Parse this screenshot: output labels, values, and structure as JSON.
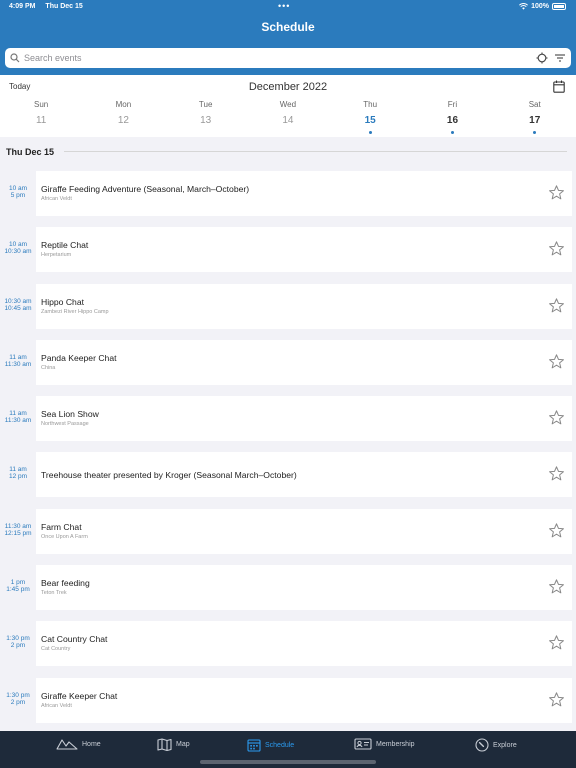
{
  "status_bar": {
    "time": "4:09 PM",
    "date": "Thu Dec 15",
    "battery": "100%"
  },
  "header": {
    "title": "Schedule"
  },
  "search": {
    "placeholder": "Search events"
  },
  "calendar": {
    "today_label": "Today",
    "month": "December 2022",
    "days": [
      {
        "name": "Sun",
        "num": "11"
      },
      {
        "name": "Mon",
        "num": "12"
      },
      {
        "name": "Tue",
        "num": "13"
      },
      {
        "name": "Wed",
        "num": "14"
      },
      {
        "name": "Thu",
        "num": "15"
      },
      {
        "name": "Fri",
        "num": "16"
      },
      {
        "name": "Sat",
        "num": "17"
      }
    ]
  },
  "list": {
    "date_header": "Thu Dec 15",
    "events": [
      {
        "start": "10 am",
        "end": "5 pm",
        "title": "Giraffe Feeding Adventure (Seasonal, March–October)",
        "location": "African Veldt"
      },
      {
        "start": "10 am",
        "end": "10:30 am",
        "title": "Reptile Chat",
        "location": "Herpetarium"
      },
      {
        "start": "10:30 am",
        "end": "10:45 am",
        "title": "Hippo Chat",
        "location": "Zambezi River Hippo Camp"
      },
      {
        "start": "11 am",
        "end": "11:30 am",
        "title": "Panda Keeper Chat",
        "location": "China"
      },
      {
        "start": "11 am",
        "end": "11:30 am",
        "title": "Sea Lion Show",
        "location": "Northwest Passage"
      },
      {
        "start": "11 am",
        "end": "12 pm",
        "title": "Treehouse theater presented by Kroger (Seasonal March–October)",
        "location": ""
      },
      {
        "start": "11:30 am",
        "end": "12:15 pm",
        "title": "Farm Chat",
        "location": "Once Upon A Farm"
      },
      {
        "start": "1 pm",
        "end": "1:45 pm",
        "title": "Bear feeding",
        "location": "Teton Trek"
      },
      {
        "start": "1:30 pm",
        "end": "2 pm",
        "title": "Cat Country Chat",
        "location": "Cat Country"
      },
      {
        "start": "1:30 pm",
        "end": "2 pm",
        "title": "Giraffe Keeper Chat",
        "location": "African Veldt"
      }
    ]
  },
  "tabbar": {
    "home": "Home",
    "map": "Map",
    "schedule": "Schedule",
    "membership": "Membership",
    "explore": "Explore"
  },
  "colors": {
    "accent": "#2b7bbd",
    "tab_active": "#2b9bf0",
    "tabbar_bg": "#1e2a3a"
  }
}
